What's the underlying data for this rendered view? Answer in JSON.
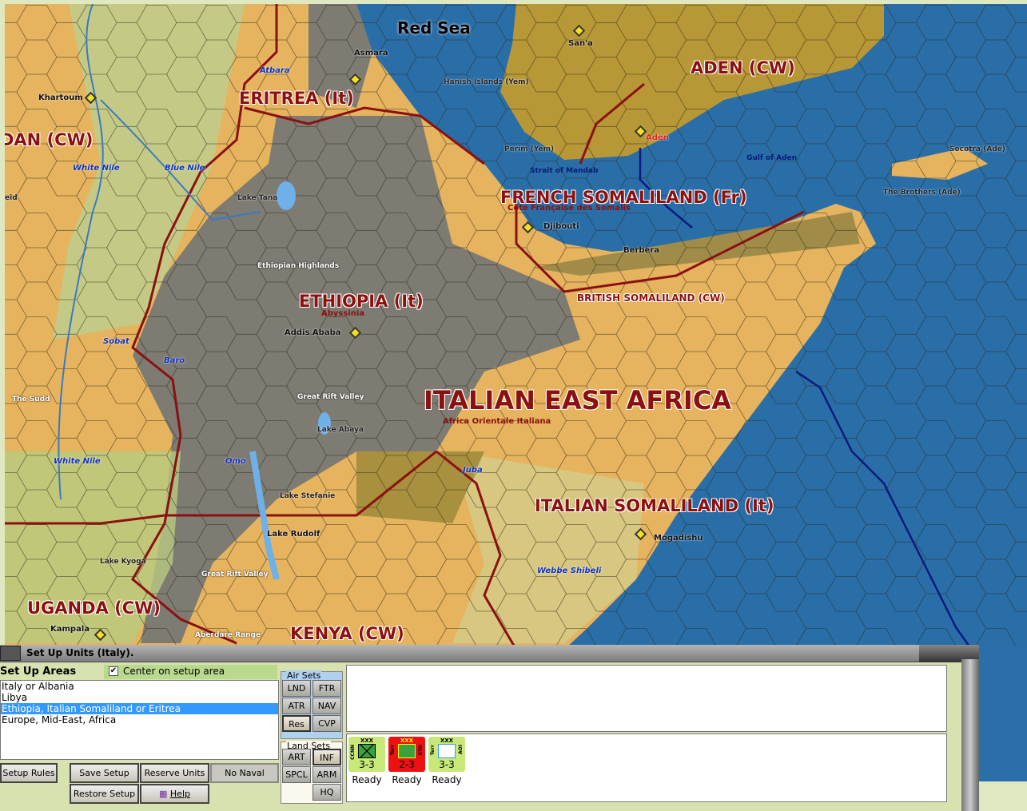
{
  "map": {
    "sea_title": "Red Sea",
    "countries": [
      "ERITREA (It)",
      "DAN (CW)",
      "ADEN (CW)",
      "FRENCH SOMALILAND (Fr)",
      "ETHIOPIA (It)",
      "BRITISH SOMALILAND (CW)",
      "ITALIAN EAST AFRICA",
      "ITALIAN SOMALILAND (It)",
      "UGANDA (CW)",
      "KENYA (CW)"
    ],
    "subtitles": [
      "Côte Française des Somalis",
      "Abyssinia",
      "Africa Orientale Italiana"
    ],
    "cities": [
      "Asmara",
      "San'a",
      "Khartoum",
      "Aden",
      "Djibouti",
      "Berbera",
      "Addis Ababa",
      "Mogadishu",
      "Kampala"
    ],
    "rivers": [
      "Atbara",
      "White Nile",
      "Blue Nile",
      "Sobat",
      "Baro",
      "White Nile",
      "Omo",
      "Juba",
      "Webbe Shibeli"
    ],
    "features": [
      "Hanish Islands (Yem)",
      "Perim (Yem)",
      "Strait of Mandab",
      "Gulf of Aden",
      "Socotra (Ade)",
      "The Brothers (Ade)",
      "Lake Tana",
      "Ethiopian Highlands",
      "Great Rift Valley",
      "Lake Abaya",
      "Lake Stefanie",
      "Lake Rudolf",
      "Lake Kyoga",
      "Great Rift Valley",
      "Aberdare Range",
      "The Sudd",
      "eid"
    ]
  },
  "panel": {
    "title": "Set Up Units (Italy).",
    "areas_header": "Set Up Areas",
    "center_checkbox": {
      "label": "Center on setup area",
      "checked": true,
      "mark": "✔"
    },
    "areas": [
      "Italy or Albania",
      "Libya",
      "Ethiopia, Italian Somaliland or Eritrea",
      "Europe, Mid-East, Africa"
    ],
    "selected_area": "Ethiopia, Italian Somaliland or Eritrea",
    "buttons": {
      "setup_rules": "Setup Rules",
      "save_setup": "Save Setup",
      "reserve_units": "Reserve Units",
      "no_naval": "No Naval",
      "restore_setup": "Restore Setup",
      "help": "Help"
    },
    "air_sets": {
      "label": "Air Sets",
      "items": [
        "LND",
        "FTR",
        "ATR",
        "NAV",
        "Res",
        "CVP"
      ]
    },
    "land_sets": {
      "label": "Land Sets",
      "items": [
        "ART",
        "INF",
        "SPCL",
        "ARM",
        "HQ"
      ]
    },
    "units": [
      {
        "size": "XXX",
        "left": "CCNN",
        "right": "",
        "value": "3-3",
        "status": "Ready",
        "color": "#c8e878"
      },
      {
        "size": "XXX",
        "left": "Terr",
        "right": "ETH",
        "value": "2-3",
        "status": "Ready",
        "color": "#ee1111"
      },
      {
        "size": "XXX",
        "left": "Terr",
        "right": "AOI",
        "value": "3-3",
        "status": "Ready",
        "color": "#c8e878"
      }
    ]
  }
}
